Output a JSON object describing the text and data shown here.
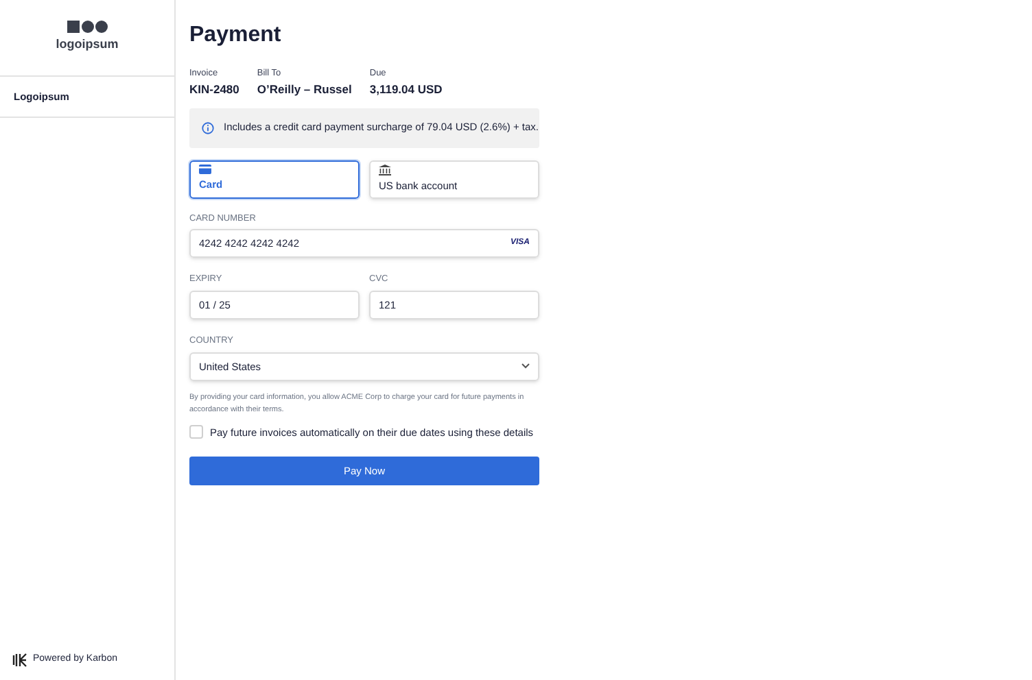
{
  "sidebar": {
    "logo_text": "logoipsum",
    "items": [
      {
        "label": "Logoipsum"
      }
    ],
    "footer": "Powered by Karbon"
  },
  "title": "Payment",
  "meta": [
    {
      "label": "Invoice",
      "value": "KIN-2480"
    },
    {
      "label": "Bill To",
      "value": "O’Reilly – Russel"
    },
    {
      "label": "Due",
      "value": "3,119.04 USD"
    }
  ],
  "notice": "Includes a credit card payment surcharge of 79.04 USD (2.6%) + tax.",
  "payment_methods": [
    {
      "kind": "card",
      "label": "Card",
      "selected": true
    },
    {
      "kind": "bank",
      "label": "US bank account",
      "selected": false
    }
  ],
  "card_number": {
    "label": "CARD NUMBER",
    "value": "4242 4242 4242 4242",
    "brand": "VISA"
  },
  "expiry": {
    "label": "EXPIRY",
    "value": "01 / 25"
  },
  "cvc": {
    "label": "CVC",
    "value": "121"
  },
  "country": {
    "label": "COUNTRY",
    "value": "United States"
  },
  "consent": "By providing your card information, you allow ACME Corp to charge your card for future payments in accordance with their terms.",
  "autopay": {
    "label": "Pay future invoices automatically on their due dates using these details",
    "checked": false
  },
  "button": "Pay Now"
}
